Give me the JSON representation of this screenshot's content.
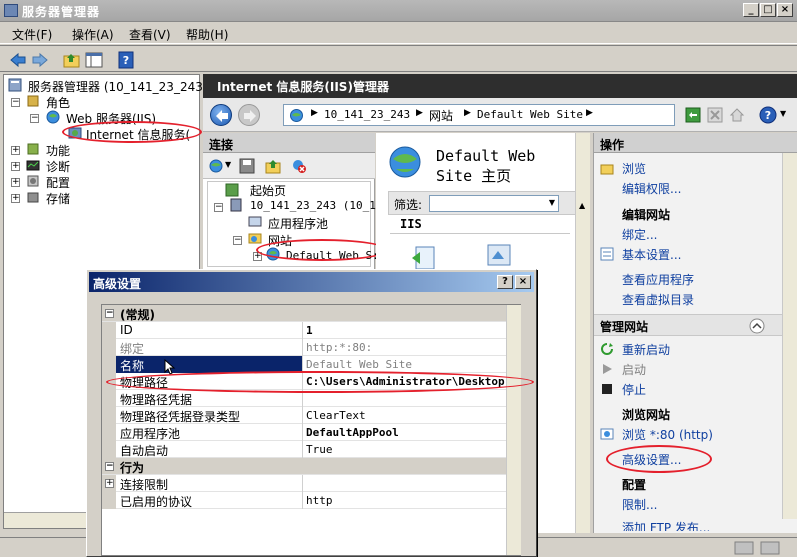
{
  "window": {
    "title": "服务器管理器",
    "controls": [
      "_",
      "□",
      "×"
    ]
  },
  "menu": [
    "文件(F)",
    "操作(A)",
    "查看(V)",
    "帮助(H)"
  ],
  "left_tree": {
    "root": "服务器管理器 (10_141_23_243)",
    "roles": "角色",
    "web_server": "Web 服务器(IIS)",
    "iis_manager": "Internet 信息服务(",
    "features": "功能",
    "diagnostics": "诊断",
    "configuration": "配置",
    "storage": "存储"
  },
  "iis": {
    "header": "Internet 信息服务(IIS)管理器",
    "breadcrumb": [
      "10_141_23_243",
      "网站",
      "Default Web Site"
    ]
  },
  "connections": {
    "title": "连接",
    "start_page": "起始页",
    "server": "10_141_23_243 (10_14",
    "app_pools": "应用程序池",
    "sites": "网站",
    "default_site": "Default Web S:"
  },
  "center": {
    "title_line1": "Default Web",
    "title_line2": "Site 主页",
    "filter_label": "筛选:",
    "section": "IIS"
  },
  "actions": {
    "title": "操作",
    "browse": "浏览",
    "edit_permissions": "编辑权限...",
    "edit_site_header": "编辑网站",
    "bindings": "绑定...",
    "basic_settings": "基本设置...",
    "view_apps": "查看应用程序",
    "view_vdirs": "查看虚拟目录",
    "manage_site_header": "管理网站",
    "restart": "重新启动",
    "start": "启动",
    "stop": "停止",
    "browse_site_header": "浏览网站",
    "browse_80": "浏览 *:80 (http)",
    "advanced_settings": "高级设置...",
    "config_header": "配置",
    "limits": "限制...",
    "add_ftp": "添加 FTP 发布..."
  },
  "dialog": {
    "title": "高级设置",
    "help": "?",
    "close": "×",
    "categories": {
      "general": "(常规)",
      "behavior": "行为"
    },
    "rows": [
      {
        "name": "ID",
        "value": "1"
      },
      {
        "name": "绑定",
        "value": "http:*:80:"
      },
      {
        "name": "名称",
        "value": "Default Web Site"
      },
      {
        "name": "物理路径",
        "value": "C:\\Users\\Administrator\\Desktop"
      },
      {
        "name": "物理路径凭据",
        "value": ""
      },
      {
        "name": "物理路径凭据登录类型",
        "value": "ClearText"
      },
      {
        "name": "应用程序池",
        "value": "DefaultAppPool"
      },
      {
        "name": "自动启动",
        "value": "True"
      }
    ],
    "behavior_rows": [
      {
        "name": "连接限制",
        "value": ""
      },
      {
        "name": "已启用的协议",
        "value": "http"
      }
    ]
  },
  "colors": {
    "annotation_red": "#e4202c",
    "link_blue": "#1040a0",
    "dialog_title": "#0a246a",
    "iis_header": "#2e2e2e"
  }
}
